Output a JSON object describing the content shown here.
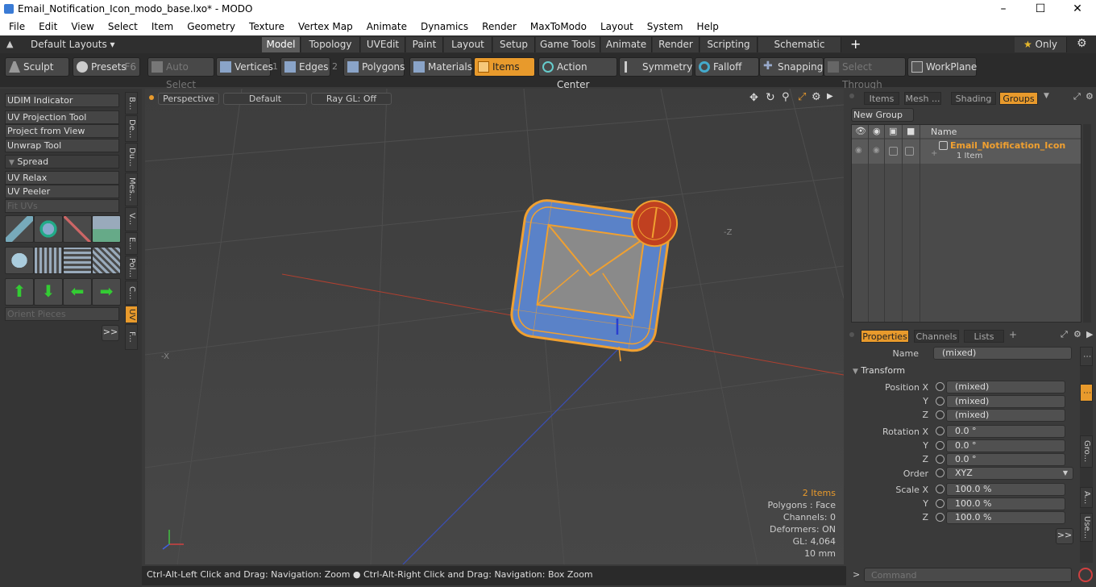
{
  "window": {
    "title": "Email_Notification_Icon_modo_base.lxo* - MODO"
  },
  "menu": [
    "File",
    "Edit",
    "View",
    "Select",
    "Item",
    "Geometry",
    "Texture",
    "Vertex Map",
    "Animate",
    "Dynamics",
    "Render",
    "MaxToModo",
    "Layout",
    "System",
    "Help"
  ],
  "layouts": {
    "label": "Default Layouts"
  },
  "tabs": [
    "Model",
    "Topology",
    "UVEdit",
    "Paint",
    "Layout",
    "Setup",
    "Game Tools",
    "Animate",
    "Render",
    "Scripting",
    "Schematic Fusion"
  ],
  "only_label": "Only",
  "toolbar": {
    "sculpt": "Sculpt",
    "presets": "Presets",
    "presets_key": "F6",
    "auto_select": "Auto Select",
    "vertices": "Vertices",
    "vertices_num": "1",
    "edges": "Edges",
    "edges_num": "2",
    "polygons": "Polygons",
    "materials": "Materials",
    "items": "Items",
    "action_center": "Action Center",
    "symmetry": "Symmetry",
    "falloff": "Falloff",
    "snapping": "Snapping",
    "select_through": "Select Through",
    "workplane": "WorkPlane"
  },
  "leftpanel": {
    "udim": "UDIM Indicator",
    "uv_projection": "UV Projection Tool",
    "project_from_view": "Project from View",
    "unwrap": "Unwrap Tool",
    "spread": "Spread",
    "uv_relax": "UV Relax",
    "uv_peeler": "UV Peeler",
    "fit_uvs": "Fit UVs",
    "orient": "Orient Pieces",
    "more": ">>",
    "vtabs": [
      "B...",
      "De...",
      "Du...",
      "Mes...",
      "V...",
      "E...",
      "Pol...",
      "C...",
      "UV",
      "F..."
    ]
  },
  "viewport": {
    "view": "Perspective",
    "shading": "Default",
    "raygl": "Ray GL: Off",
    "items": "2 Items",
    "polygons": "Polygons : Face",
    "channels": "Channels: 0",
    "deformers": "Deformers: ON",
    "gl": "GL: 4,064",
    "unit": "10 mm",
    "axis_neg_x": "-X",
    "axis_neg_z": "-Z"
  },
  "status": {
    "text": "Ctrl-Alt-Left Click and Drag: Navigation: Zoom ● Ctrl-Alt-Right Click and Drag: Navigation: Box Zoom"
  },
  "groups": {
    "tabs": [
      "Items",
      "Mesh ...",
      "Shading",
      "Groups"
    ],
    "new_group": "New Group",
    "col_name": "Name",
    "item_name": "Email_Notification_Icon",
    "item_count": "1 Item"
  },
  "properties": {
    "tabs": [
      "Properties",
      "Channels",
      "Lists"
    ],
    "name_label": "Name",
    "name_value": "(mixed)",
    "transform": "Transform",
    "pos_label": "Position X",
    "rot_label": "Rotation X",
    "scale_label": "Scale X",
    "y": "Y",
    "z": "Z",
    "pos": [
      "(mixed)",
      "(mixed)",
      "(mixed)"
    ],
    "rot": [
      "0.0 °",
      "0.0 °",
      "0.0 °"
    ],
    "order_label": "Order",
    "order_value": "XYZ",
    "scale": [
      "100.0 %",
      "100.0 %",
      "100.0 %"
    ],
    "more": ">>",
    "side_tabs": [
      "Gro...",
      "A...",
      "Use..."
    ]
  },
  "command": {
    "placeholder": "Command"
  },
  "colors": {
    "accent": "#e89a2c",
    "bg": "#3a3a3a"
  }
}
